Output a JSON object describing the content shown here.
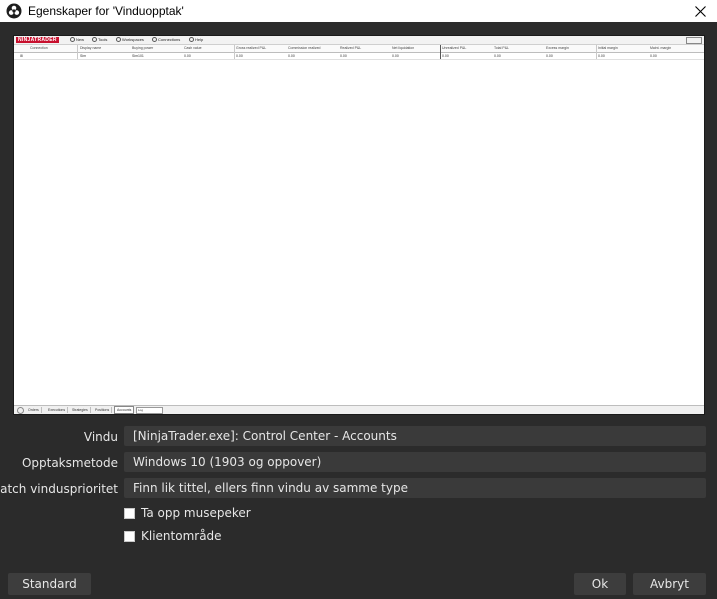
{
  "window": {
    "title": "Egenskaper for 'Vinduopptak'",
    "icon": "obs-logo-icon",
    "close_icon": "close-icon"
  },
  "preview": {
    "logo": "NINJATRADER",
    "menu": [
      {
        "label": "New",
        "icon": "new-icon"
      },
      {
        "label": "Tools",
        "icon": "tools-icon"
      },
      {
        "label": "Workspaces",
        "icon": "workspaces-icon"
      },
      {
        "label": "Connections",
        "icon": "connections-icon"
      },
      {
        "label": "Help",
        "icon": "help-icon"
      }
    ],
    "grid_headers": [
      "Connection",
      "Display name",
      "Buying power",
      "Cash value",
      "Gross realized P&L",
      "Commission realized",
      "Realized P&L",
      "Net liquidation",
      "Unrealized P&L",
      "Total P&L",
      "Excess margin",
      "Initial margin",
      "Maint. margin"
    ],
    "grid_row": [
      "Sim",
      "Sim101",
      "0.00",
      "0.00",
      "0.00",
      "0.00",
      "0.00",
      "0.00",
      "0.00",
      "0.00",
      "0.00",
      "0.00",
      "0.00"
    ],
    "tabs": [
      "Orders",
      "Executions",
      "Strategies",
      "Positions",
      "Accounts"
    ],
    "active_tab": "Accounts",
    "tab_select": "Log"
  },
  "properties": {
    "window": {
      "label": "Vindu",
      "value": "[NinjaTrader.exe]: Control Center - Accounts"
    },
    "capture_method": {
      "label": "Opptaksmetode",
      "value": "Windows 10 (1903 og oppover)"
    },
    "window_match": {
      "label": "Match vindusprioritet",
      "value": "Finn lik tittel, ellers finn vindu av samme type"
    },
    "capture_cursor": {
      "label": "Ta opp musepeker",
      "checked": false
    },
    "client_area": {
      "label": "Klientområde",
      "checked": false
    }
  },
  "buttons": {
    "defaults": "Standard",
    "ok": "Ok",
    "cancel": "Avbryt"
  },
  "colors": {
    "background": "#2b2b2b",
    "field": "#3a3a3a",
    "button": "#3d3d3d",
    "text": "#e6e6e6",
    "ninjatrader_red": "#c8102e"
  }
}
